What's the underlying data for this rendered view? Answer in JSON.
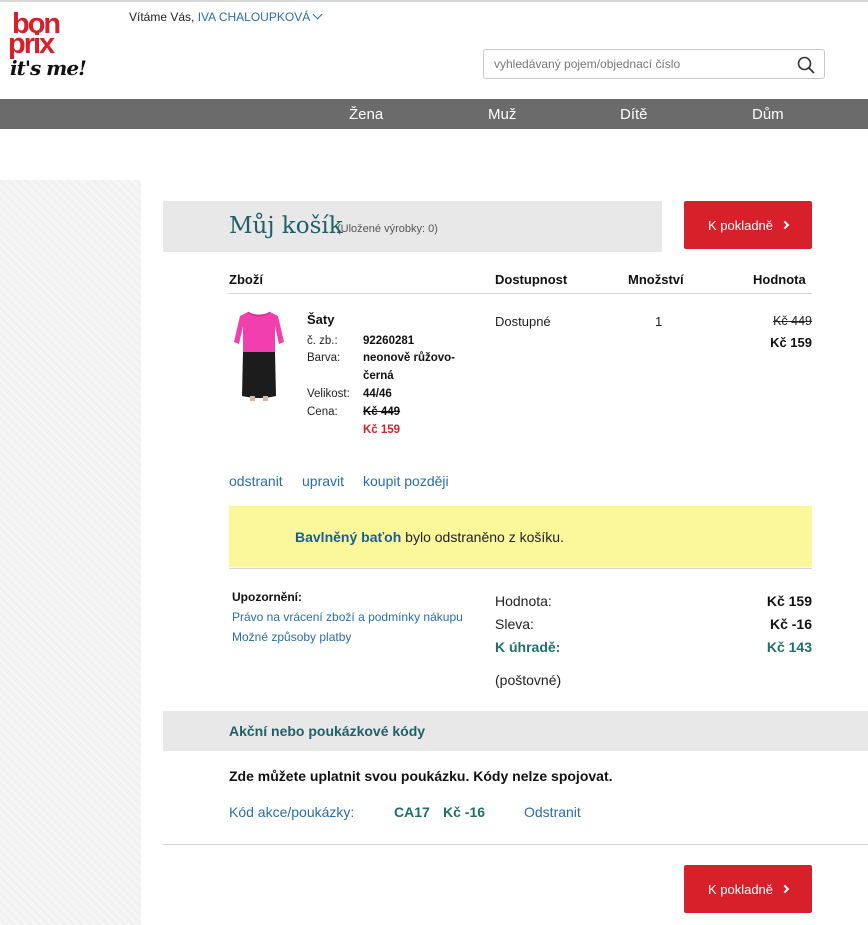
{
  "header": {
    "logo_line1": "bon",
    "logo_line2": "prix",
    "logo_tagline": "it's me!",
    "welcome": "Vítáme Vás,",
    "user_name": "IVA CHALOUPKOVÁ",
    "search_placeholder": "vyhledávaný pojem/objednací číslo"
  },
  "nav": [
    "Žena",
    "Muž",
    "Dítě",
    "Dům"
  ],
  "cart": {
    "title": "Můj košík",
    "saved_items": "(Uložené výrobky: 0)",
    "checkout_label": "K pokladně",
    "columns": {
      "goods": "Zboží",
      "availability": "Dostupnost",
      "quantity": "Množství",
      "value": "Hodnota"
    },
    "item": {
      "name": "Šaty",
      "order_no_label": "č. zb.:",
      "order_no": "92260281",
      "color_label": "Barva:",
      "color_line1": "neonově růžovo-",
      "color_line2": "černá",
      "size_label": "Velikost:",
      "size": "44/46",
      "price_label": "Cena:",
      "price_old": "Kč 449",
      "price_new": "Kč 159",
      "availability": "Dostupné",
      "quantity": "1",
      "value_old": "Kč 449",
      "value_new": "Kč 159"
    },
    "actions": {
      "remove": "odstranit",
      "edit": "upravit",
      "buy_later": "koupit později"
    },
    "notice": {
      "product": "Bavlněný baťoh",
      "text": " bylo odstraněno z košíku."
    },
    "warning": {
      "title": "Upozornění:",
      "link1": "Právo na vrácení zboží a podmínky nákupu",
      "link2": "Možné způsoby platby"
    },
    "summary": {
      "value_label": "Hodnota:",
      "value": "Kč 159",
      "discount_label": "Sleva:",
      "discount": "Kč -16",
      "total_label": "K úhradě:",
      "total": "Kč 143",
      "shipping": "(poštovné)"
    },
    "codes": {
      "title": "Akční nebo poukázkové kódy",
      "note": "Zde můžete uplatnit svou poukázku. Kódy nelze spojovat.",
      "label": "Kód akce/poukázky:",
      "code": "CA17",
      "amount": "Kč -16",
      "remove": "Odstranit"
    }
  },
  "colors": {
    "brand_red": "#d8202a",
    "nav_gray": "#6b6b6b",
    "link_blue": "#2a6ea8",
    "teal": "#1f6f6a",
    "notice_yellow": "#fbf89c"
  }
}
